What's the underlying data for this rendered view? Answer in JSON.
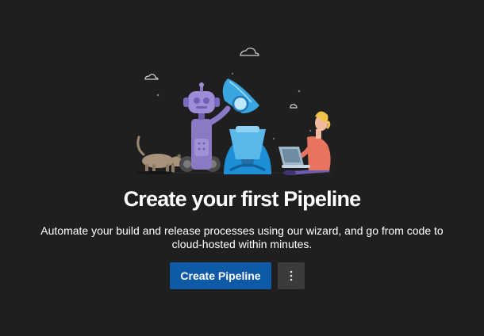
{
  "empty_state": {
    "title": "Create your first Pipeline",
    "description": "Automate your build and release processes using our wizard, and go from code to cloud-hosted within minutes.",
    "primary_button_label": "Create Pipeline",
    "more_actions_icon": "more-vertical-icon"
  },
  "colors": {
    "background": "#1f1f1f",
    "primary_button": "#0f5aa6",
    "secondary_button": "#3b3b3b",
    "text": "#ffffff"
  },
  "illustration": {
    "icon": "pipeline-illustration"
  }
}
